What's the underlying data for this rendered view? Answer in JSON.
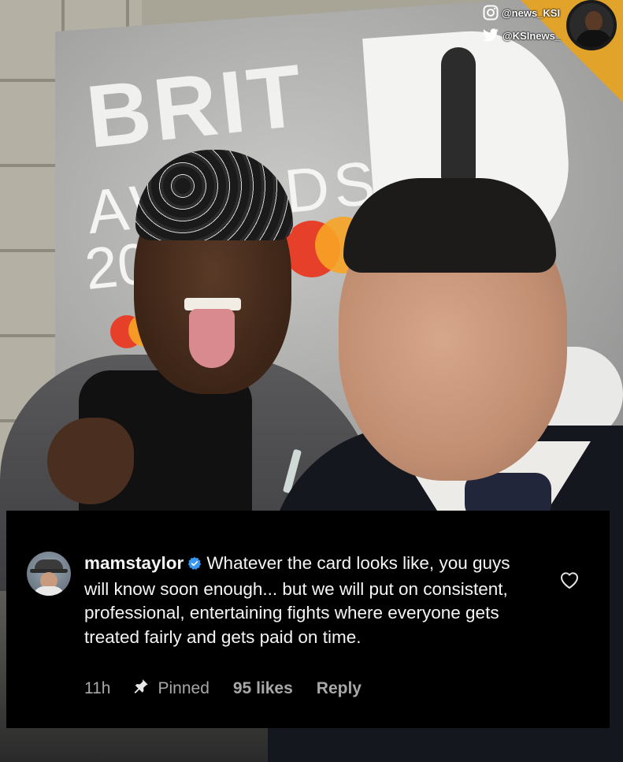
{
  "watermark": {
    "instagram_handle": "@news_KSI",
    "twitter_handle": "@KSInews_",
    "instagram_icon": "instagram-icon",
    "twitter_icon": "twitter-bird-icon",
    "accent_color": "#e2a32b"
  },
  "backdrop": {
    "line1": "BRIT",
    "line2": "AWARDS",
    "line3": "20"
  },
  "comment": {
    "username": "mamstaylor",
    "verified_icon": "verified-badge-icon",
    "text": "Whatever the card looks like, you guys will know soon enough... but we will put on consistent, professional, entertaining fights where everyone gets treated fairly and gets paid on time.",
    "time": "11h",
    "pinned_icon": "pin-icon",
    "pinned_label": "Pinned",
    "likes": "95 likes",
    "reply_label": "Reply",
    "like_icon": "heart-outline-icon",
    "colors": {
      "panel_bg": "#000000",
      "text": "#f5f5f5",
      "meta": "#a8a8a8",
      "verified": "#3897f0"
    }
  }
}
